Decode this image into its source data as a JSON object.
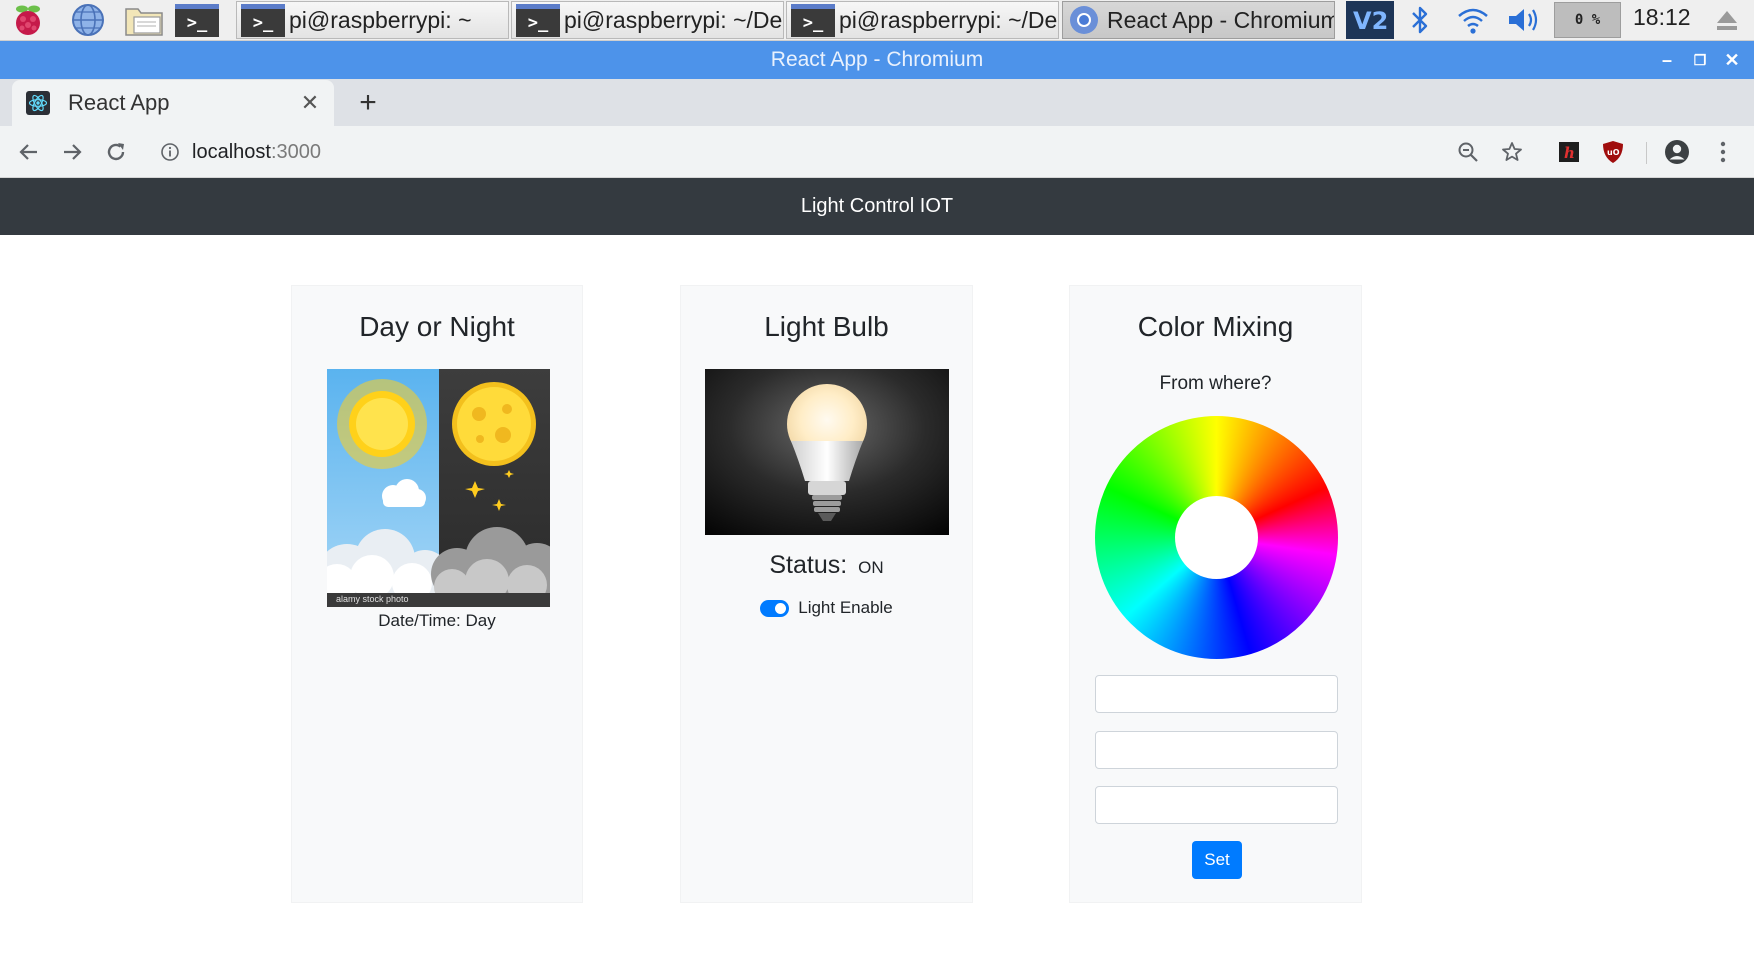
{
  "taskbar": {
    "tasks": [
      {
        "label": "pi@raspberrypi: ~"
      },
      {
        "label": "pi@raspberrypi: ~/De..."
      },
      {
        "label": "pi@raspberrypi: ~/De..."
      },
      {
        "label": "React App - Chromium"
      }
    ],
    "cpu": "0 %",
    "clock": "18:12"
  },
  "window": {
    "title": "React App - Chromium"
  },
  "browser": {
    "tab_title": "React App",
    "url_host": "localhost",
    "url_port": ":3000"
  },
  "app": {
    "navbar_title": "Light Control IOT",
    "day_night": {
      "title": "Day or Night",
      "caption": "Date/Time: Day",
      "watermark": "alamy stock photo"
    },
    "light_bulb": {
      "title": "Light Bulb",
      "status_label": "Status:",
      "status_value": "ON",
      "switch_label": "Light Enable",
      "switch_on": true
    },
    "color_mixing": {
      "title": "Color Mixing",
      "subtitle": "From where?",
      "inputs": [
        "",
        "",
        ""
      ],
      "set_label": "Set"
    }
  },
  "colors": {
    "titlebar": "#4d93ea",
    "navbar": "#343a40",
    "primary": "#007bff",
    "card_bg": "#f8f9fa"
  }
}
